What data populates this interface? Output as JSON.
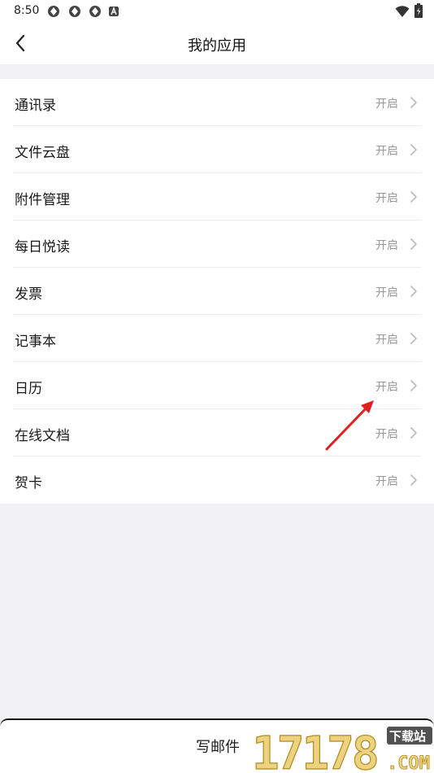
{
  "status_bar": {
    "time": "8:50",
    "icons": [
      "app-notification-icon",
      "app-notification-icon",
      "app-notification-icon",
      "a-notification-icon",
      "wifi-icon",
      "battery-icon"
    ]
  },
  "nav": {
    "title": "我的应用",
    "back_icon": "chevron-left-icon"
  },
  "apps": [
    {
      "label": "通讯录",
      "status": "开启"
    },
    {
      "label": "文件云盘",
      "status": "开启"
    },
    {
      "label": "附件管理",
      "status": "开启"
    },
    {
      "label": "每日悦读",
      "status": "开启"
    },
    {
      "label": "发票",
      "status": "开启"
    },
    {
      "label": "记事本",
      "status": "开启"
    },
    {
      "label": "日历",
      "status": "开启"
    },
    {
      "label": "在线文档",
      "status": "开启"
    },
    {
      "label": "贺卡",
      "status": "开启"
    }
  ],
  "bottom_bar": {
    "compose_label": "写邮件"
  },
  "watermark": {
    "text": "17178",
    "badge": "下载站",
    "suffix": ".COM"
  },
  "colors": {
    "background": "#f2f2f4",
    "surface": "#ffffff",
    "secondary_text": "#999999",
    "annotation_arrow": "#e02020",
    "watermark_gold": "#e8c860"
  }
}
